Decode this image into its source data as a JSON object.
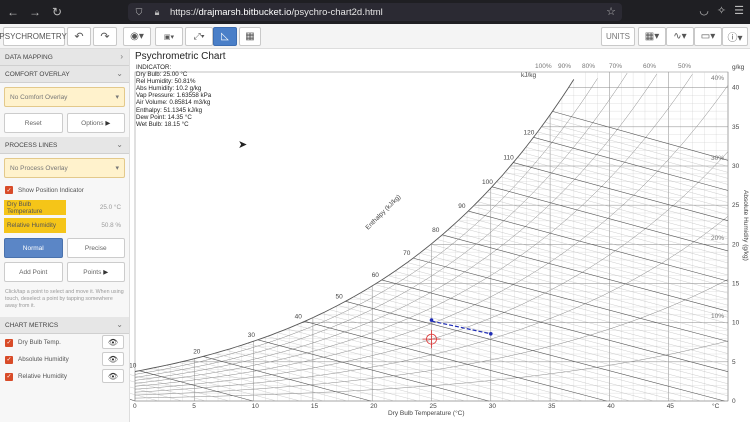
{
  "browser": {
    "url_prefix": "https://",
    "url_host": "drajmarsh.bitbucket.io",
    "url_path": "/psychro-chart2d.html",
    "back_icon": "arrow-left-icon",
    "forward_icon": "arrow-right-icon",
    "reload_icon": "reload-icon"
  },
  "toolbar": {
    "psychrometry_label": "PSYCHROMETRY:",
    "units_label": "UNITS"
  },
  "sidebar": {
    "data_mapping": "DATA MAPPING",
    "comfort_overlay": "COMFORT OVERLAY",
    "comfort_select": "No Comfort Overlay",
    "reset_label": "Reset",
    "options_label": "Options",
    "process_lines": "PROCESS LINES",
    "process_select": "No Process Overlay",
    "show_position": "Show Position Indicator",
    "dry_bulb_label": "Dry Bulb Temperature",
    "dry_bulb_value": "25.0 °C",
    "rel_hum_label": "Relative Humidity",
    "rel_hum_value": "50.8 %",
    "normal_label": "Normal",
    "precise_label": "Precise",
    "add_point_label": "Add Point",
    "points_label": "Points",
    "hint": "Click/tap a point to select and move it. When using touch, deselect a point by tapping somewhere away from it.",
    "chart_metrics": "CHART METRICS",
    "metrics": [
      "Dry Bulb Temp.",
      "Absolute Humidity",
      "Relative Humidity"
    ]
  },
  "chart": {
    "title": "Psychrometric Chart",
    "indicator_lines": [
      "INDICATOR:",
      "Dry Bulb: 25.00 °C",
      "Rel Humidity: 50.81%",
      "Abs Humidity: 10.2 g/kg",
      "Vap Pressure: 1.63558 kPa",
      "Air Volume: 0.85814 m3/kg",
      "Enthalpy: 51.1345 kJ/kg",
      "Dew Point: 14.35 °C",
      "Wet Bulb: 18.15 °C"
    ],
    "x_title": "Dry Bulb Temperature (°C)",
    "x_unit": "°C",
    "x_ticks": [
      "0",
      "5",
      "10",
      "15",
      "20",
      "25",
      "30",
      "35",
      "40",
      "45"
    ],
    "y_title": "Absolute Humidity (g/kg)",
    "y_unit": "g/kg",
    "y_ticks": [
      "0",
      "5",
      "10",
      "15",
      "20",
      "25",
      "30",
      "35",
      "40"
    ],
    "enthalpy_title": "Enthalpy (kJ/kg)",
    "enthalpy_unit": "kJ/kg",
    "enthalpy_ticks": [
      "10",
      "20",
      "30",
      "40",
      "50",
      "60",
      "70",
      "80",
      "90",
      "100",
      "110",
      "120"
    ],
    "rh_labels": [
      "100%",
      "90%",
      "80%",
      "70%",
      "60%",
      "50%",
      "40%",
      "30%",
      "20%",
      "10%"
    ],
    "process_line": {
      "color": "#1f2db5"
    }
  }
}
